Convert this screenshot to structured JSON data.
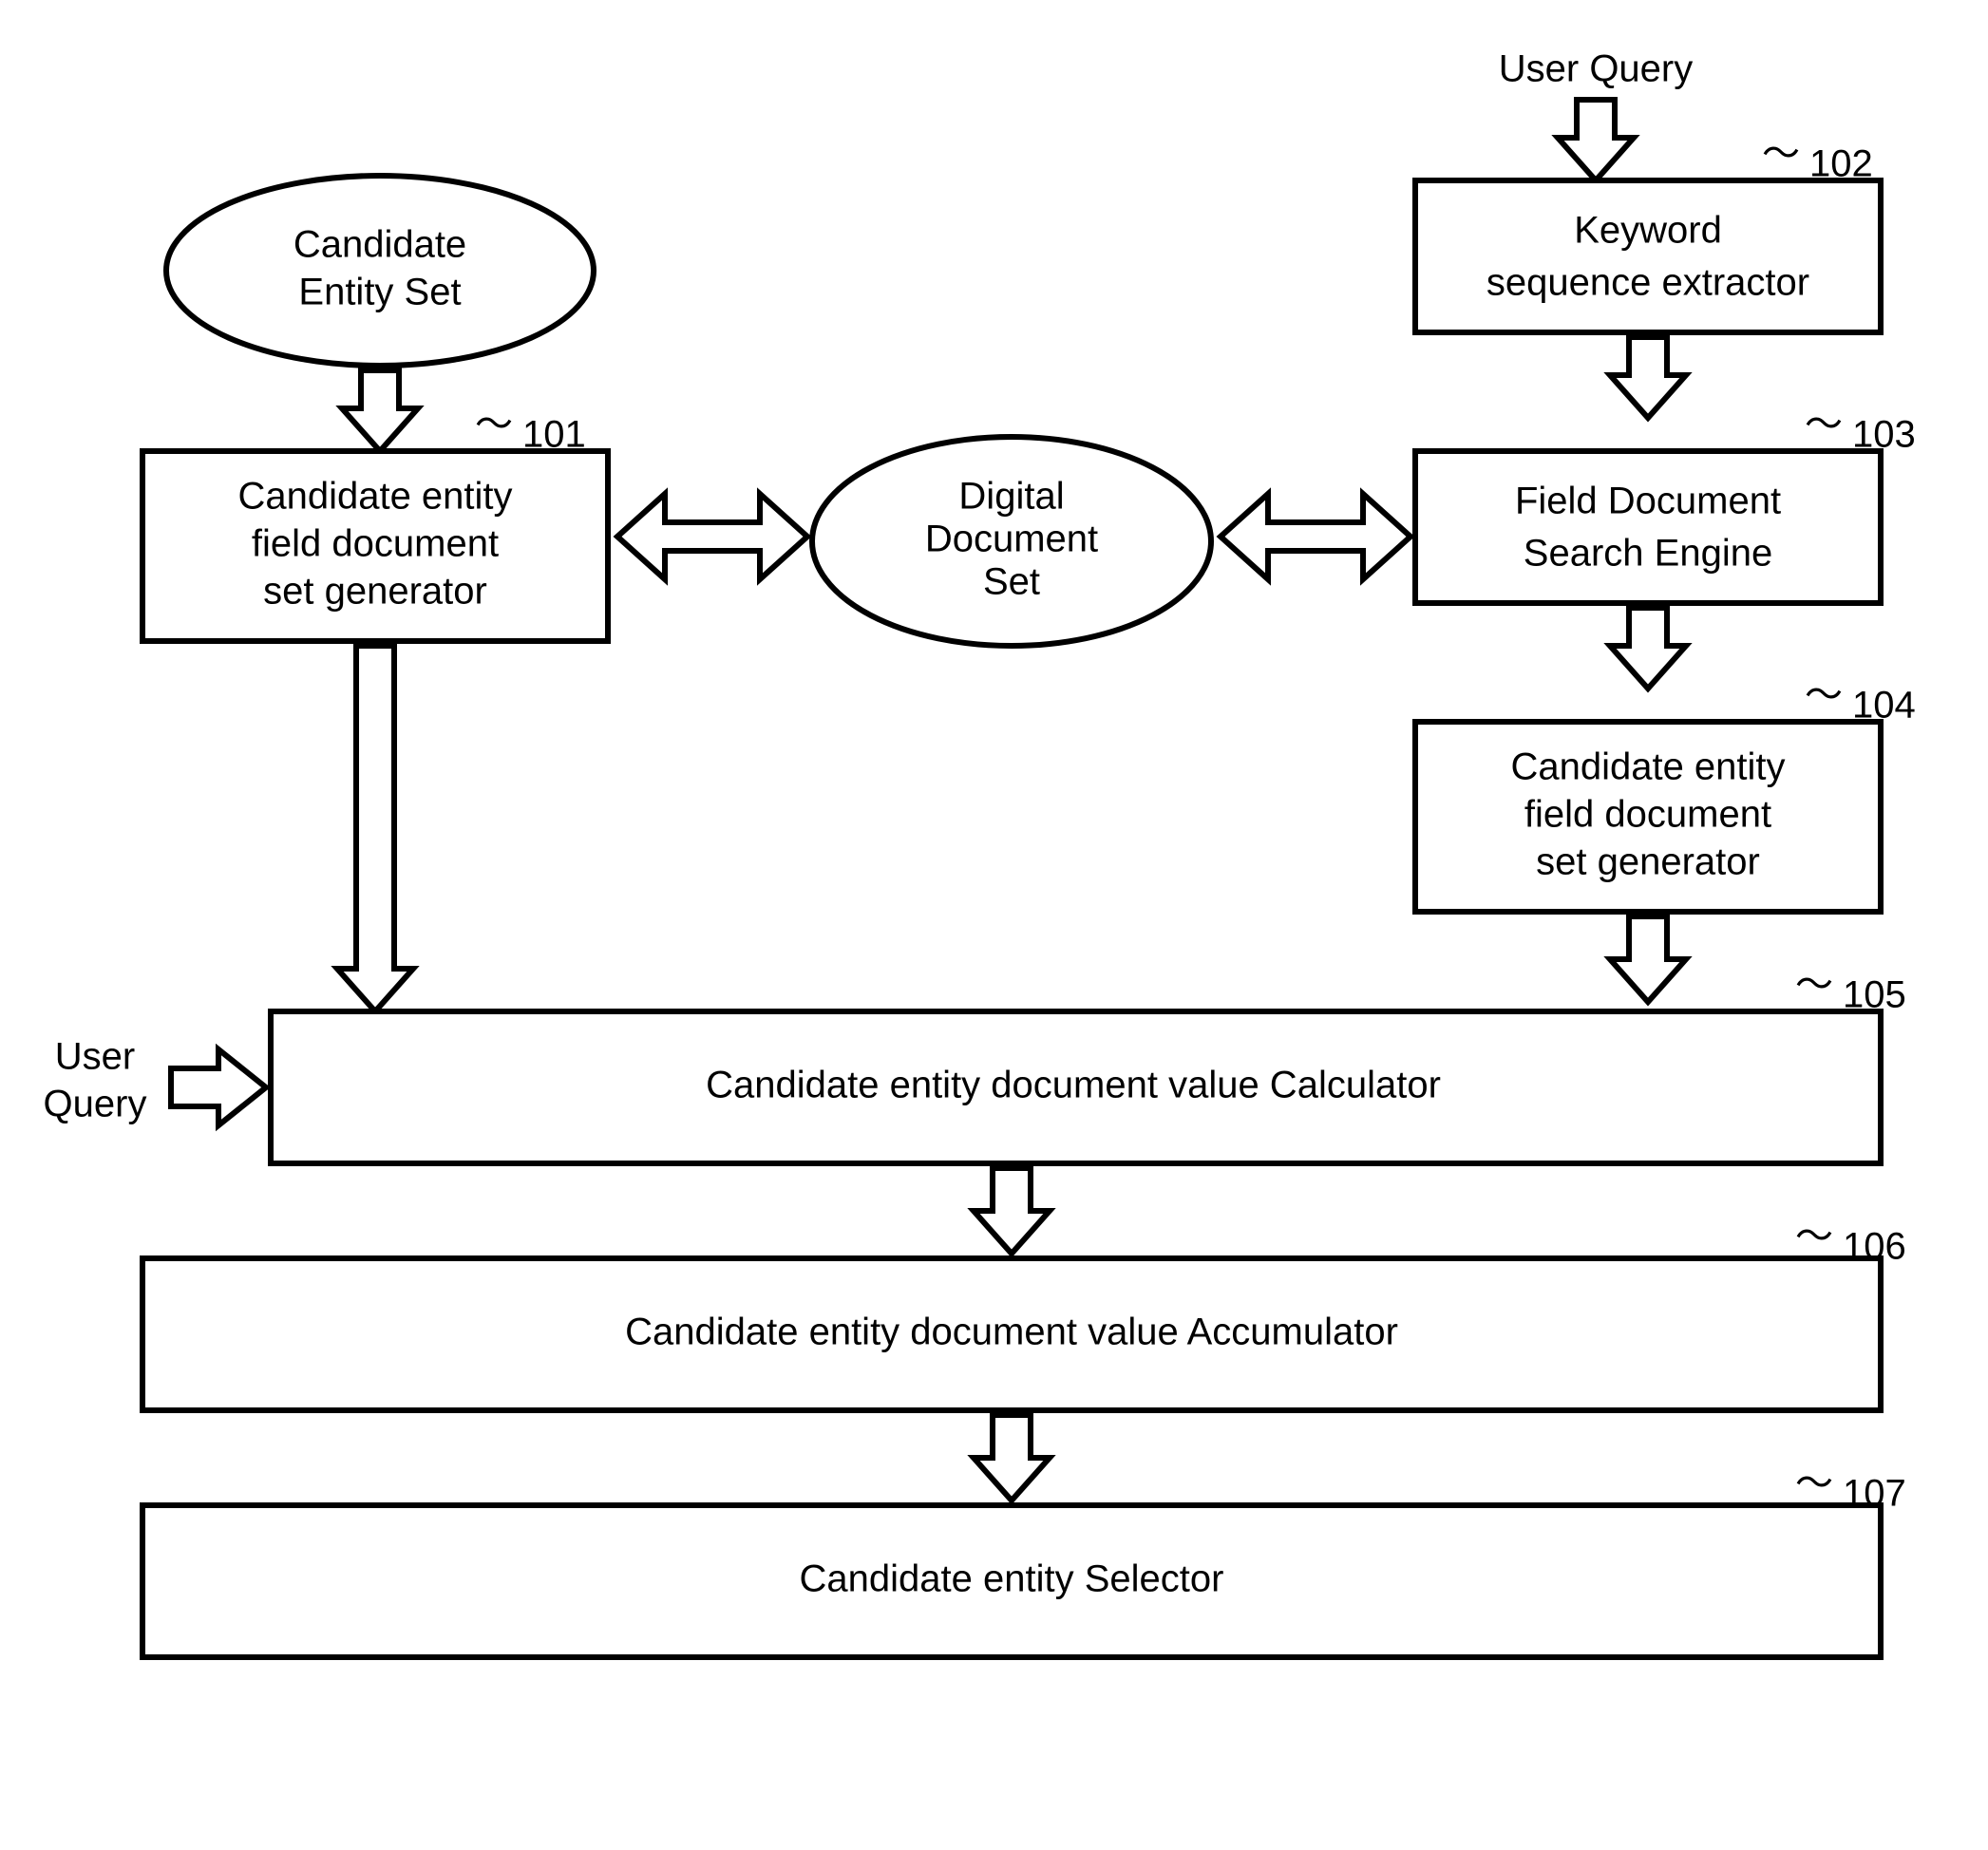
{
  "labels": {
    "user_query_top": "User Query",
    "user_query_left": "User\nQuery",
    "candidate_entity_set": "Candidate\nEntity Set",
    "digital_document_set": "Digital\nDocument\nSet"
  },
  "boxes": {
    "b101": {
      "ref": "101",
      "text": "Candidate entity\nfield document\nset generator"
    },
    "b102": {
      "ref": "102",
      "text": "Keyword\nsequence extractor"
    },
    "b103": {
      "ref": "103",
      "text": "Field Document\nSearch Engine"
    },
    "b104": {
      "ref": "104",
      "text": "Candidate entity\nfield document\nset generator"
    },
    "b105": {
      "ref": "105",
      "text": "Candidate entity document value Calculator"
    },
    "b106": {
      "ref": "106",
      "text": "Candidate entity document value Accumulator"
    },
    "b107": {
      "ref": "107",
      "text": "Candidate entity Selector"
    }
  }
}
